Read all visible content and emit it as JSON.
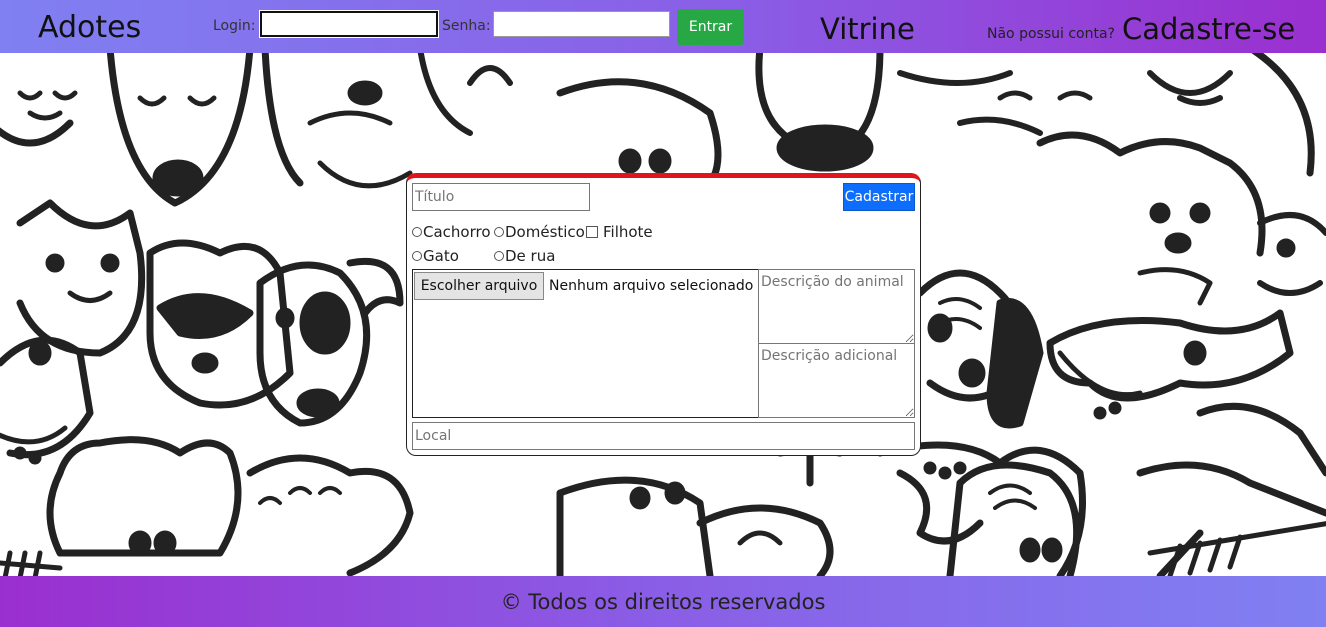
{
  "header": {
    "brand": "Adotes",
    "login_label": "Login:",
    "login_value": "",
    "senha_label": "Senha:",
    "senha_value": "",
    "entrar_label": "Entrar",
    "vitrine": "Vitrine",
    "no_account": "Não possui conta?",
    "signup": "Cadastre-se"
  },
  "form": {
    "titulo_placeholder": "Título",
    "cadastrar_label": "Cadastrar",
    "species_options": [
      "Cachorro",
      "Gato"
    ],
    "origin_options": [
      "Doméstico",
      "De rua"
    ],
    "filhote_label": "Filhote",
    "file_button_label": "Escolher arquivo",
    "file_status": "Nenhum arquivo selecionado",
    "descricao_animal_placeholder": "Descrição do animal",
    "descricao_adicional_placeholder": "Descrição adicional",
    "local_placeholder": "Local"
  },
  "footer": {
    "text": "© Todos os direitos reservados"
  },
  "colors": {
    "header_gradient_start": "#8080f2",
    "header_gradient_end": "#9a2fcf",
    "entrar_button": "#28a745",
    "cadastrar_button": "#0d6efd",
    "card_top_border": "#e0141b"
  }
}
